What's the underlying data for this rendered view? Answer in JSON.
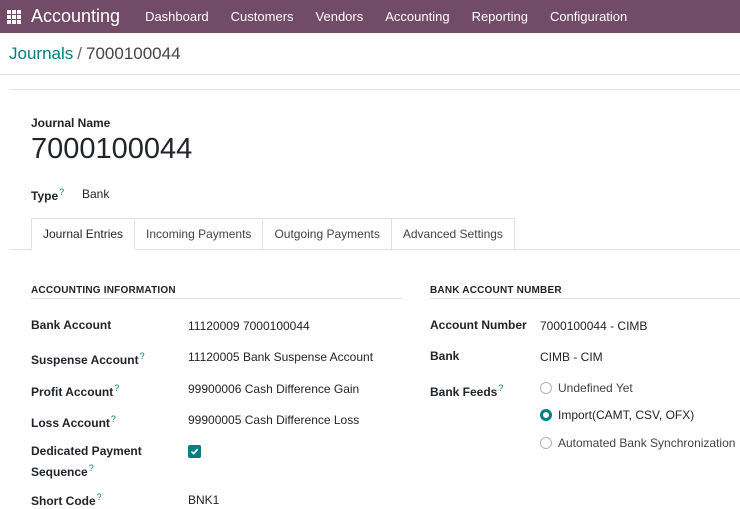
{
  "navbar": {
    "app_name": "Accounting",
    "menu": [
      "Dashboard",
      "Customers",
      "Vendors",
      "Accounting",
      "Reporting",
      "Configuration"
    ]
  },
  "breadcrumb": {
    "parent": "Journals",
    "separator": "/",
    "current": "7000100044"
  },
  "form": {
    "journal_name_label": "Journal Name",
    "journal_name": "7000100044",
    "type_label": "Type",
    "type_value": "Bank",
    "help_mark": "?"
  },
  "tabs": [
    "Journal Entries",
    "Incoming Payments",
    "Outgoing Payments",
    "Advanced Settings"
  ],
  "accounting_info": {
    "title": "ACCOUNTING INFORMATION",
    "bank_account_label": "Bank Account",
    "bank_account_value": "11120009 7000100044",
    "suspense_label": "Suspense Account",
    "suspense_value": "11120005 Bank Suspense Account",
    "profit_label": "Profit Account",
    "profit_value": "99900006 Cash Difference Gain",
    "loss_label": "Loss Account",
    "loss_value": "99900005 Cash Difference Loss",
    "dedicated_label_1": "Dedicated Payment",
    "dedicated_label_2": "Sequence",
    "short_code_label": "Short Code",
    "short_code_value": "BNK1"
  },
  "bank_account": {
    "title": "BANK ACCOUNT NUMBER",
    "account_number_label": "Account Number",
    "account_number_value": "7000100044 - CIMB",
    "bank_label": "Bank",
    "bank_value": "CIMB - CIM",
    "bank_feeds_label": "Bank Feeds",
    "feeds": [
      "Undefined Yet",
      "Import(CAMT, CSV, OFX)",
      "Automated Bank Synchronization"
    ],
    "selected_feed": "Import(CAMT, CSV, OFX)"
  },
  "colors": {
    "navbar": "#714b67",
    "accent": "#017e84"
  }
}
